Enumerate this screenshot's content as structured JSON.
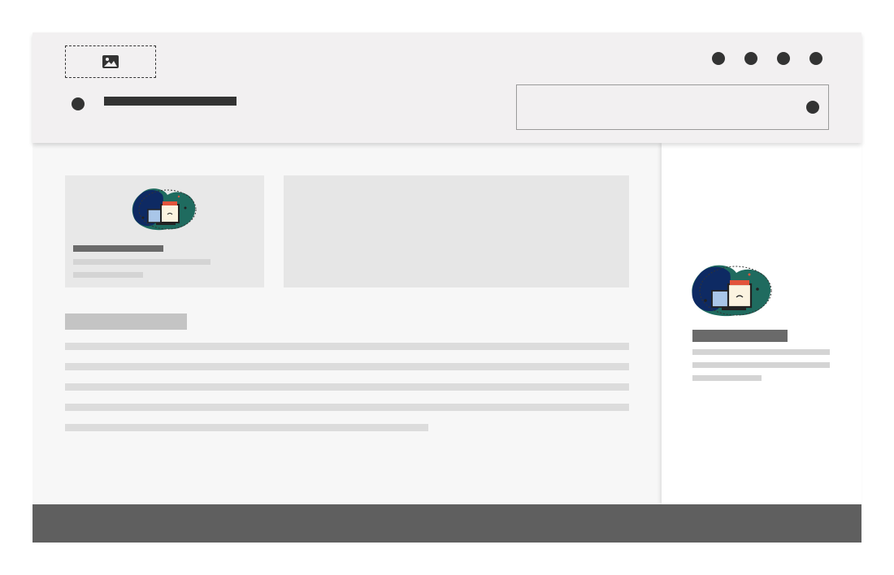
{
  "window": {
    "title": ""
  },
  "header": {
    "logo": {
      "icon": "image-icon"
    },
    "nav_dots": [
      "nav-dot",
      "nav-dot",
      "nav-dot",
      "nav-dot"
    ],
    "title_placeholder": "",
    "search": {
      "value": "",
      "placeholder": "",
      "icon": "search-dot"
    }
  },
  "main": {
    "card": {
      "illustration": "computer-devices-illustration",
      "title": "",
      "lines": [
        "",
        ""
      ]
    },
    "banner": {
      "content": ""
    },
    "section": {
      "heading": "",
      "paragraph_lines": [
        "",
        "",
        "",
        "",
        ""
      ]
    }
  },
  "sidebar": {
    "illustration": "computer-devices-illustration",
    "title": "",
    "lines": [
      "",
      "",
      ""
    ]
  },
  "footer": {
    "text": ""
  },
  "colors": {
    "header_bg": "#f2f0f1",
    "content_bg": "#f7f7f7",
    "card_bg": "#e8e8e8",
    "dark_text": "#333333",
    "skeleton_light": "#d9d9d9",
    "footer_bg": "#5f5f5f",
    "illustration_navy": "#0e2a63",
    "illustration_teal": "#1f6b5f"
  }
}
